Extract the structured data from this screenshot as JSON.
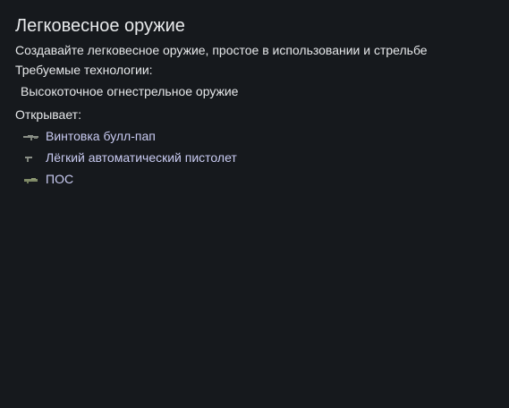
{
  "tech": {
    "title": "Легковесное оружие",
    "description": "Создавайте легковесное оружие, простое в использовании и стрельбе",
    "required_label": "Требуемые технологии:",
    "required": [
      "Высокоточное огнестрельное оружие"
    ],
    "unlocks_label": "Открывает:",
    "unlocks": [
      {
        "label": "Винтовка булл-пап",
        "icon": "rifle-icon"
      },
      {
        "label": "Лёгкий автоматический пистолет",
        "icon": "pistol-icon"
      },
      {
        "label": "ПОС",
        "icon": "launcher-icon"
      }
    ]
  },
  "colors": {
    "background": "#16191d",
    "text": "#e6e8ea",
    "link": "#c9cbf2",
    "icon": "#8a8f87"
  }
}
